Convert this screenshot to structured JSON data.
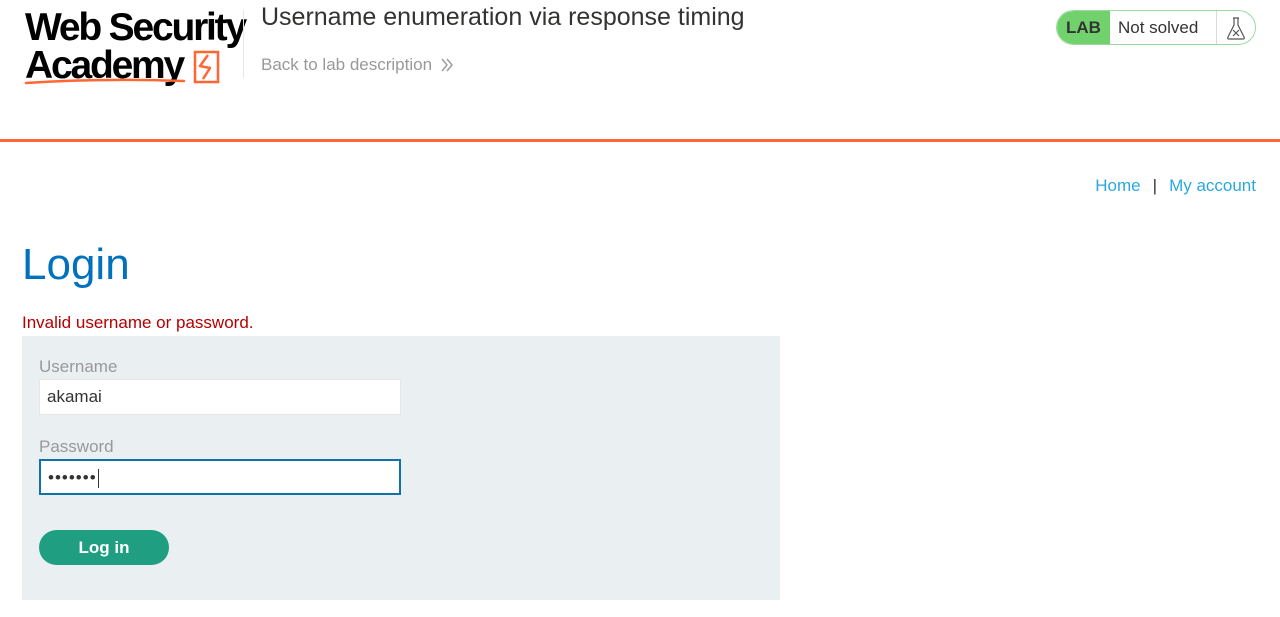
{
  "header": {
    "logo_line1": "Web Security",
    "logo_line2": "Academy",
    "lab_title": "Username enumeration via response timing",
    "back_link": "Back to lab description",
    "back_icon": "double-chevron-right-icon"
  },
  "lab_status": {
    "badge": "LAB",
    "state": "Not solved",
    "icon": "flask-icon",
    "badge_color": "#70d16d"
  },
  "nav": {
    "home": "Home",
    "separator": "|",
    "my_account": "My account"
  },
  "main": {
    "title": "Login",
    "error": "Invalid username or password.",
    "username_label": "Username",
    "username_value": "akamai",
    "password_label": "Password",
    "password_mask": "•••••••",
    "login_button": "Log in"
  },
  "colors": {
    "accent_orange": "#ff6633",
    "title_blue": "#0071bc",
    "link_blue": "#29a8e0",
    "error_red": "#b50000",
    "button_green": "#1f9e82",
    "panel_bg": "#eaeff2"
  }
}
